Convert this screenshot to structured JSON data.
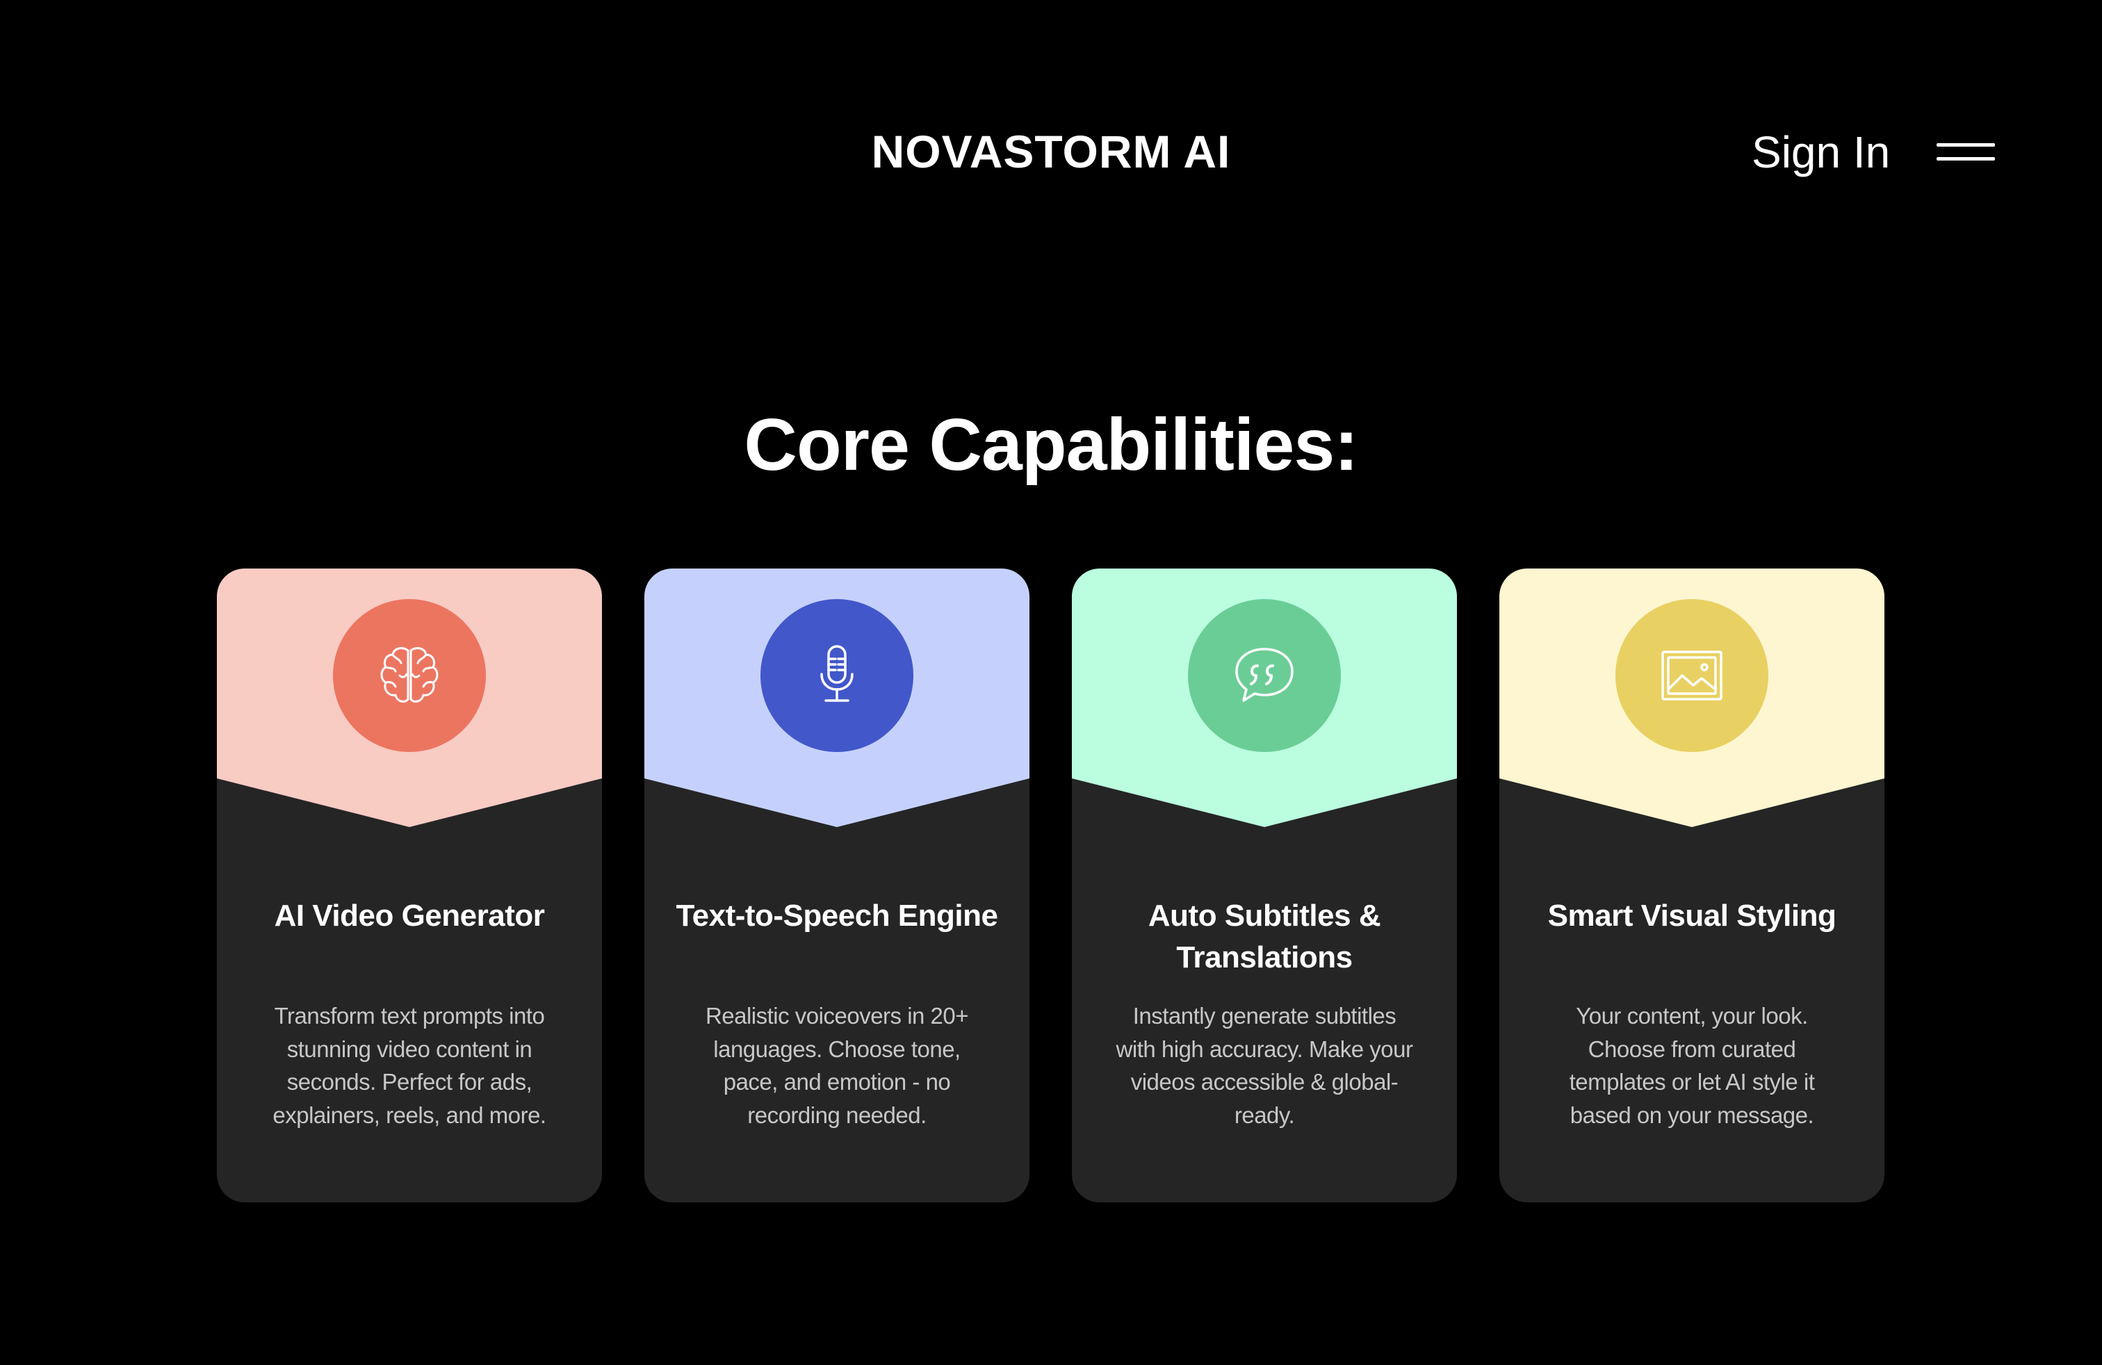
{
  "header": {
    "brand": "NOVASTORM AI",
    "signin_label": "Sign In",
    "menu_icon": "hamburger-menu-icon"
  },
  "section": {
    "title": "Core Capabilities:"
  },
  "cards": [
    {
      "title": "AI Video Generator",
      "description": "Transform text prompts into stunning video content in seconds. Perfect for ads, explainers, reels, and more.",
      "icon": "brain-icon",
      "header_color": "#F8CBC3",
      "circle_color": "#EC7560"
    },
    {
      "title": "Text-to-Speech Engine",
      "description": "Realistic voiceovers in 20+ languages. Choose tone, pace, and emotion - no recording needed.",
      "icon": "microphone-icon",
      "header_color": "#C5D1FC",
      "circle_color": "#4257CA"
    },
    {
      "title": "Auto Subtitles & Translations",
      "description": "Instantly generate subtitles with high accuracy. Make your videos accessible & global-ready.",
      "icon": "quote-bubble-icon",
      "header_color": "#BAFDDF",
      "circle_color": "#6BCD96"
    },
    {
      "title": "Smart Visual Styling",
      "description": "Your content, your look. Choose from curated templates or let AI style it based on your message.",
      "icon": "image-icon",
      "header_color": "#FDF6D0",
      "circle_color": "#E9D062"
    }
  ]
}
